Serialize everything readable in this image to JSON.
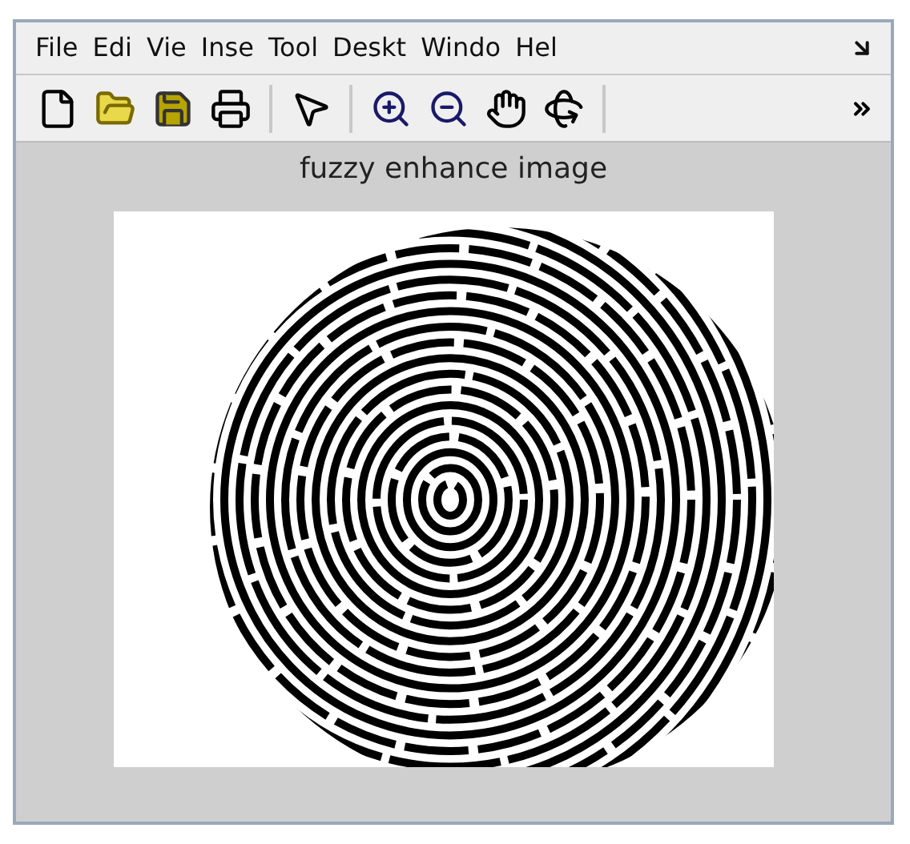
{
  "menu_bar": {
    "items": [
      "File",
      "Edi",
      "Vie",
      "Inse",
      "Tool",
      "Deskt",
      "Windo",
      "Hel"
    ]
  },
  "figure": {
    "title": "fuzzy enhance image"
  }
}
